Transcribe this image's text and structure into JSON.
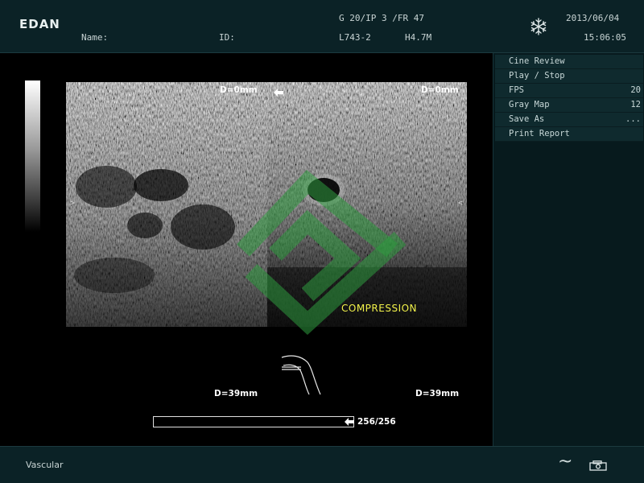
{
  "header": {
    "logo": "EDAN",
    "name_label": "Name:",
    "id_label": "ID:",
    "params_line1": "G 20/IP 3 /FR 47",
    "probe": "L743-2",
    "frequency": "H4.7M",
    "date": "2013/06/04",
    "time": "15:06:05",
    "freeze_icon": "snowflake-icon"
  },
  "menu": {
    "items": [
      {
        "label": "Cine Review",
        "value": ""
      },
      {
        "label": "Play / Stop",
        "value": ""
      },
      {
        "label": "FPS",
        "value": "20"
      },
      {
        "label": "Gray Map",
        "value": "12"
      },
      {
        "label": "Save As",
        "value": "..."
      },
      {
        "label": "Print Report",
        "value": ""
      }
    ]
  },
  "image": {
    "left_depth_top": "D=0mm",
    "right_depth_top": "D=0mm",
    "left_depth_bottom": "D=39mm",
    "right_depth_bottom": "D=39mm",
    "left_marker": ">",
    "right_marker": "<",
    "annotation": "COMPRESSION",
    "watermark_color": "#2e9a3e"
  },
  "cine": {
    "frame_text": "256/256",
    "progress": 1.0
  },
  "footer": {
    "preset": "Vascular",
    "wave_symbol": "~",
    "printer_icon": "printer-icon"
  },
  "colors": {
    "panel_bg": "#0b2226",
    "annotation": "#f2f24a"
  }
}
